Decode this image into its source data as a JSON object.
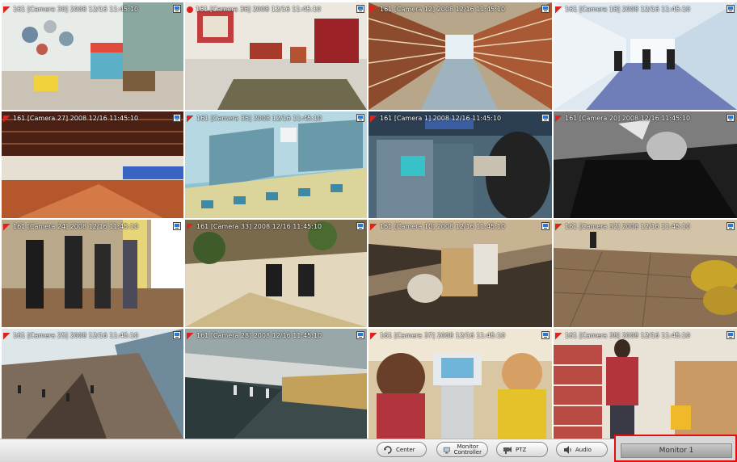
{
  "cameras": [
    {
      "label": "161 [Camera 30] 2008 12/16 11:45:10",
      "rec_color": "#22bb22"
    },
    {
      "label": "161 [Camera 36] 2008 12/16 11:45:10",
      "rec_color": "#dd2222"
    },
    {
      "label": "161 [Camera 12] 2008 12/16 11:45:10",
      "rec_color": "#22bb22"
    },
    {
      "label": "161 [Camera 18] 2008 12/16 11:45:10",
      "rec_color": "#22bb22"
    },
    {
      "label": "161 [Camera 27] 2008 12/16 11:45:10",
      "rec_color": "#22bb22"
    },
    {
      "label": "161 [Camera 35] 2008 12/16 11:45:10",
      "rec_color": "#22bb22"
    },
    {
      "label": "161 [Camera 1] 2008 12/16 11:45:10",
      "rec_color": "#22bb22"
    },
    {
      "label": "161 [Camera 20] 2008 12/16 11:45:10",
      "rec_color": "#22bb22"
    },
    {
      "label": "161 [Camera 24] 2008 12/16 11:45:10",
      "rec_color": "#22bb22"
    },
    {
      "label": "161 [Camera 33] 2008 12/16 11:45:10",
      "rec_color": "#22bb22"
    },
    {
      "label": "161 [Camera 10] 2008 12/16 11:45:10",
      "rec_color": "#22bb22"
    },
    {
      "label": "161 [Camera 32] 2008 12/16 11:45:10",
      "rec_color": "#22bb22"
    },
    {
      "label": "161 [Camera 25] 2008 12/16 11:45:10",
      "rec_color": "#22bb22"
    },
    {
      "label": "161 [Camera 28] 2008 12/16 11:45:10",
      "rec_color": "#22bb22"
    },
    {
      "label": "161 [Camera 37] 2008 12/16 11:45:10",
      "rec_color": "#22bb22"
    },
    {
      "label": "161 [Camera 38] 2008 12/16 11:45:10",
      "rec_color": "#22bb22"
    }
  ],
  "toolbar": {
    "center_label": "Center",
    "monitor_controller_line1": "Monitor",
    "monitor_controller_line2": "Controller",
    "ptz_label": "PTZ",
    "audio_label": "Audio"
  },
  "monitor_label": "Monitor 1",
  "scene_icons": [
    "playroom",
    "classroom",
    "library",
    "corridor",
    "gym",
    "station",
    "atm",
    "portrait",
    "business",
    "handshake",
    "escalator",
    "plaza",
    "airport",
    "train",
    "conference",
    "market"
  ]
}
